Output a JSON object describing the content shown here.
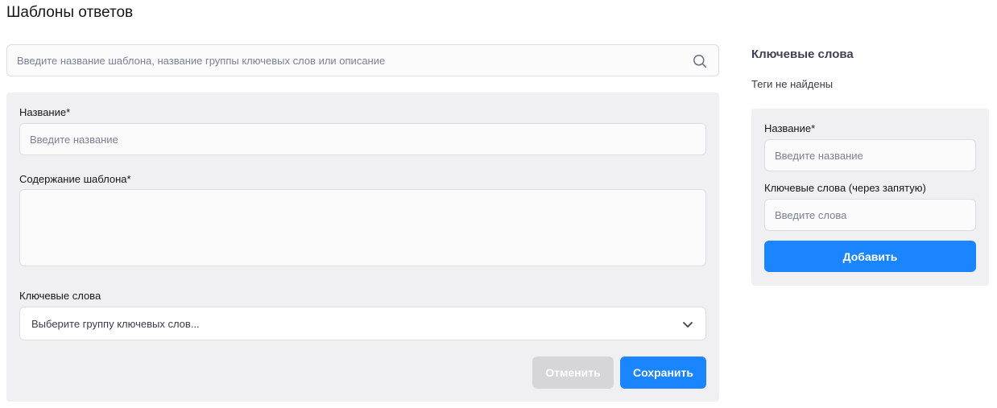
{
  "page": {
    "title": "Шаблоны ответов"
  },
  "search": {
    "placeholder": "Введите название шаблона, название группы ключевых слов или описание",
    "icon": "search-icon"
  },
  "template_form": {
    "name_label": "Название*",
    "name_placeholder": "Введите название",
    "content_label": "Содержание шаблона*",
    "content_value": "",
    "keywords_label": "Ключевые слова",
    "keywords_select_value": "Выберите группу ключевых слов...",
    "cancel_label": "Отменить",
    "save_label": "Сохранить"
  },
  "keywords_sidebar": {
    "title": "Ключевые слова",
    "empty_text": "Теги не найдены",
    "form": {
      "name_label": "Название*",
      "name_placeholder": "Введите название",
      "words_label": "Ключевые слова (через запятую)",
      "words_placeholder": "Введите слова",
      "add_label": "Добавить"
    }
  },
  "colors": {
    "accent": "#1a85ff",
    "panel_bg": "#f0f0f3",
    "disabled_button": "#d6d6d9"
  }
}
